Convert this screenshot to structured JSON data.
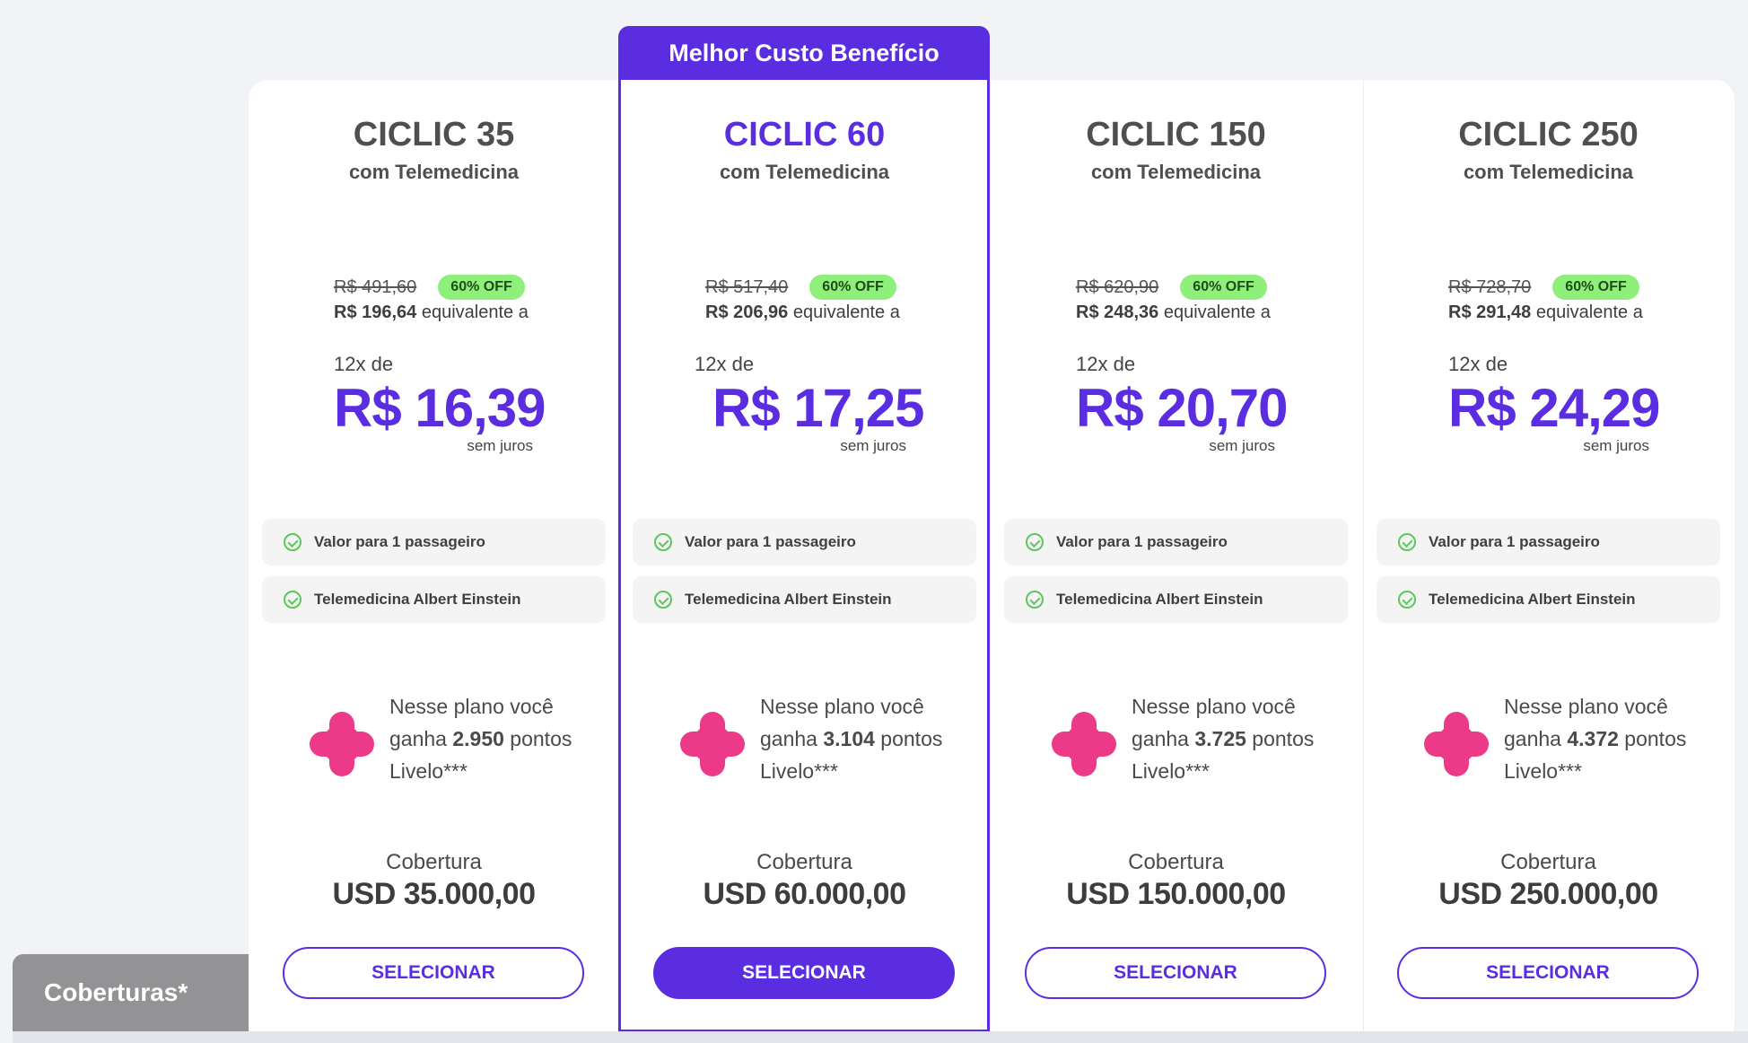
{
  "banner": "Melhor Custo Benefício",
  "plans": [
    {
      "title": "CICLIC 35",
      "subtitle": "com Telemedicina",
      "old_price": "R$ 491,60",
      "discount": "60% OFF",
      "new_price": "R$ 196,64",
      "equiv_text": " equivalente a",
      "installments": "12x de",
      "installment_value": "R$ 16,39",
      "no_interest": "sem juros",
      "features": [
        "Valor para 1 passageiro",
        "Telemedicina Albert Einstein"
      ],
      "livelo_pre": "Nesse plano você ganha ",
      "livelo_points": "2.950",
      "livelo_post": " pontos Livelo***",
      "coverage_label": "Cobertura",
      "coverage_value": "USD 35.000,00",
      "button": "SELECIONAR"
    },
    {
      "title": "CICLIC 60",
      "subtitle": "com Telemedicina",
      "old_price": "R$ 517,40",
      "discount": "60% OFF",
      "new_price": "R$ 206,96",
      "equiv_text": " equivalente a",
      "installments": "12x de",
      "installment_value": "R$ 17,25",
      "no_interest": "sem juros",
      "features": [
        "Valor para 1 passageiro",
        "Telemedicina Albert Einstein"
      ],
      "livelo_pre": "Nesse plano você ganha ",
      "livelo_points": "3.104",
      "livelo_post": " pontos Livelo***",
      "coverage_label": "Cobertura",
      "coverage_value": "USD 60.000,00",
      "button": "SELECIONAR"
    },
    {
      "title": "CICLIC 150",
      "subtitle": "com Telemedicina",
      "old_price": "R$ 620,90",
      "discount": "60% OFF",
      "new_price": "R$ 248,36",
      "equiv_text": " equivalente a",
      "installments": "12x de",
      "installment_value": "R$ 20,70",
      "no_interest": "sem juros",
      "features": [
        "Valor para 1 passageiro",
        "Telemedicina Albert Einstein"
      ],
      "livelo_pre": "Nesse plano você ganha ",
      "livelo_points": "3.725",
      "livelo_post": " pontos Livelo***",
      "coverage_label": "Cobertura",
      "coverage_value": "USD 150.000,00",
      "button": "SELECIONAR"
    },
    {
      "title": "CICLIC 250",
      "subtitle": "com Telemedicina",
      "old_price": "R$ 728,70",
      "discount": "60% OFF",
      "new_price": "R$ 291,48",
      "equiv_text": " equivalente a",
      "installments": "12x de",
      "installment_value": "R$ 24,29",
      "no_interest": "sem juros",
      "features": [
        "Valor para 1 passageiro",
        "Telemedicina Albert Einstein"
      ],
      "livelo_pre": "Nesse plano você ganha ",
      "livelo_points": "4.372",
      "livelo_post": " pontos Livelo***",
      "coverage_label": "Cobertura",
      "coverage_value": "USD 250.000,00",
      "button": "SELECIONAR"
    }
  ],
  "coverage_tab": "Coberturas*",
  "colors": {
    "accent": "#5a2ee0",
    "discount_badge": "#8ef07a",
    "livelo": "#ec3a88",
    "check": "#5bc85a"
  }
}
